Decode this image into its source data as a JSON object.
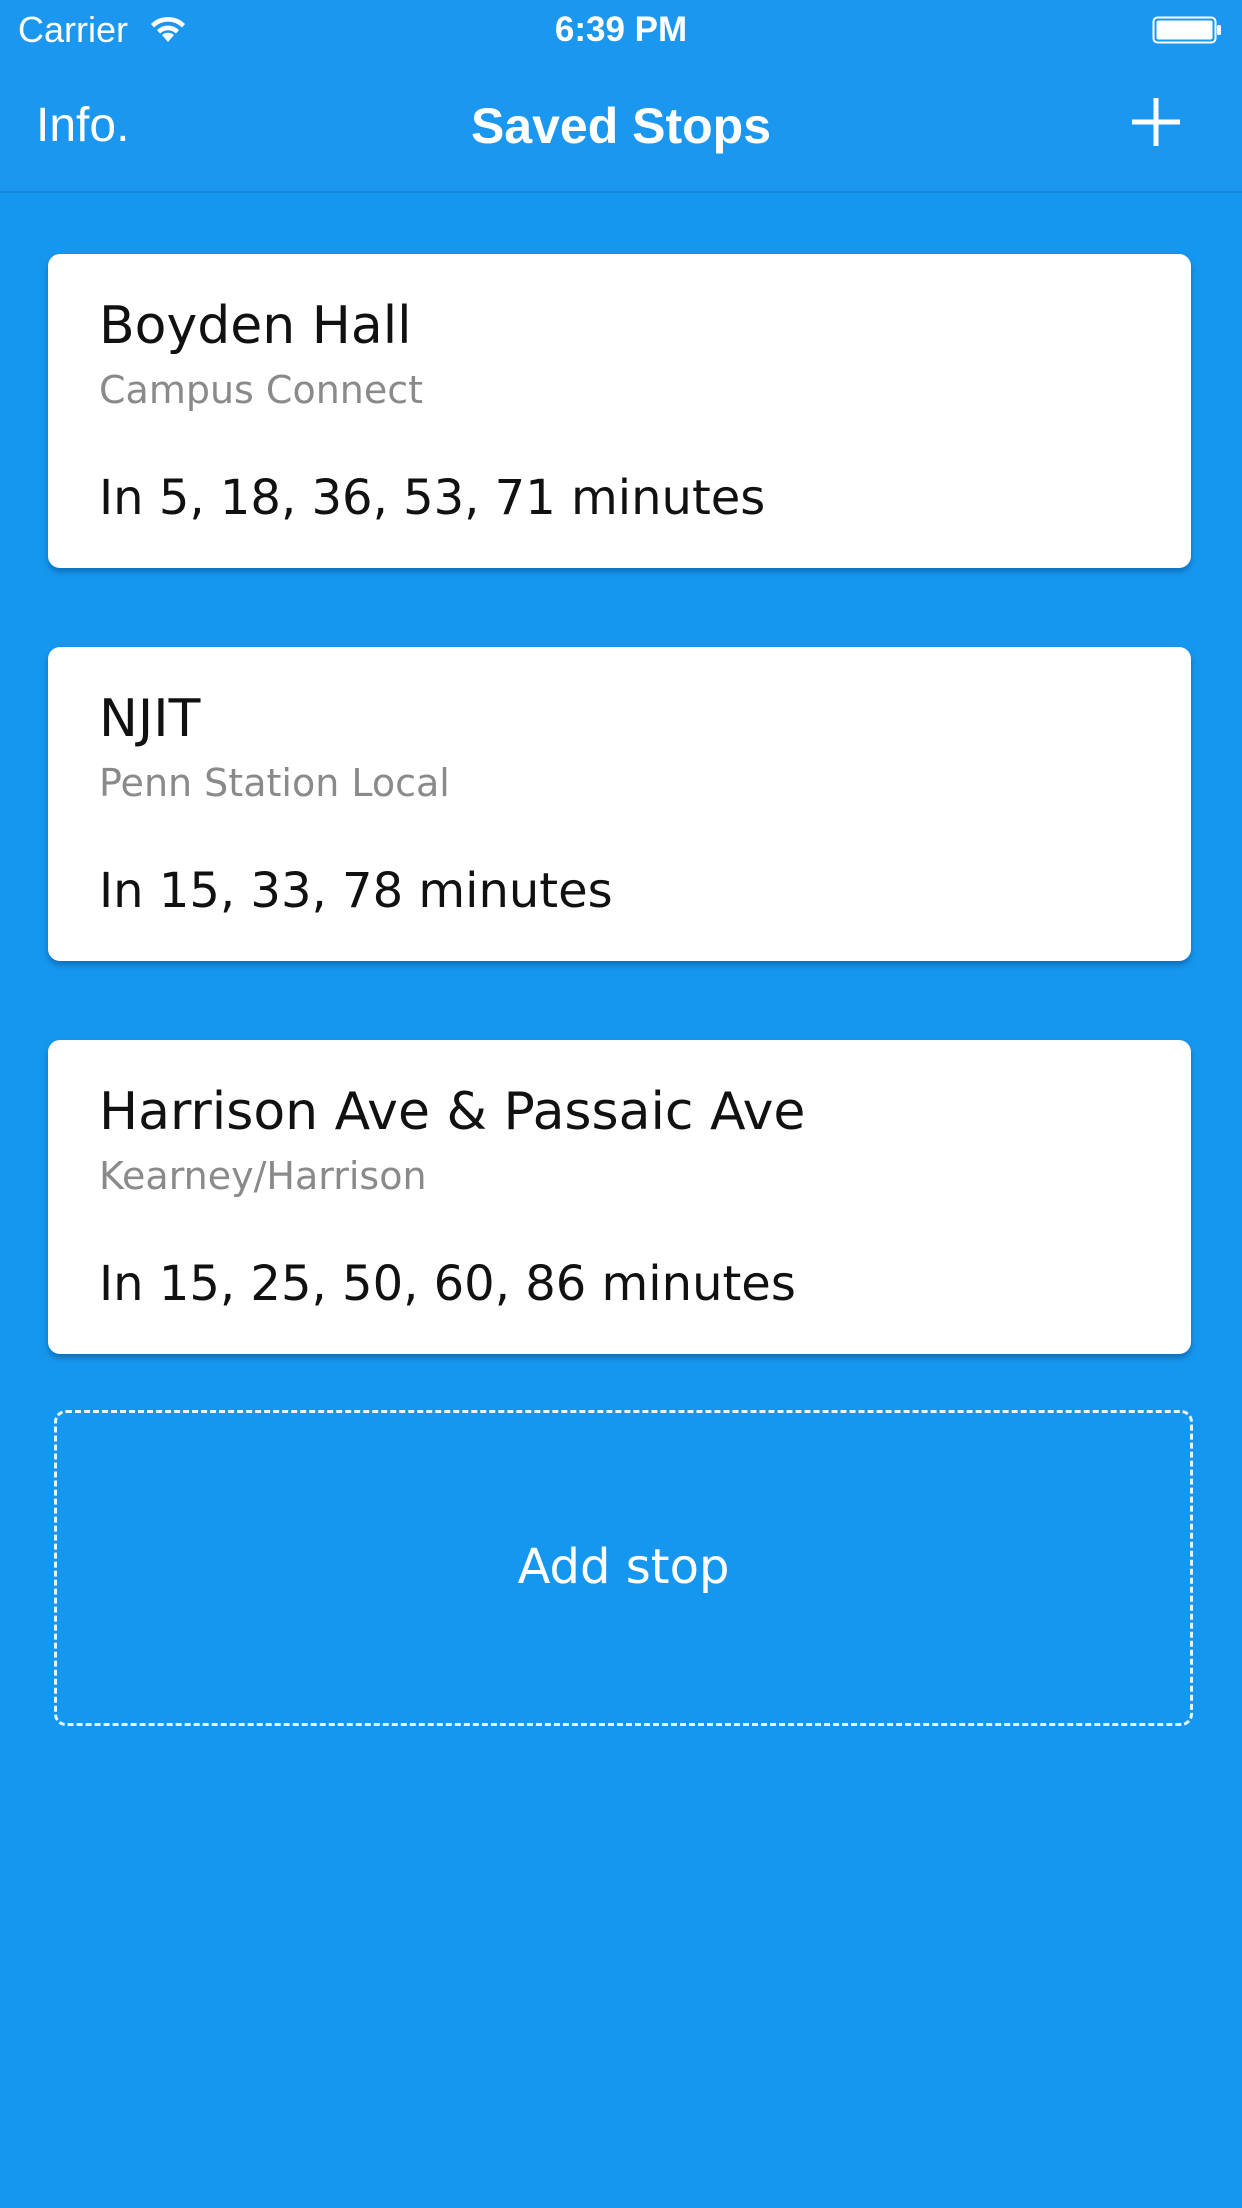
{
  "status_bar": {
    "carrier": "Carrier",
    "time": "6:39 PM"
  },
  "nav": {
    "left_label": "Info.",
    "title": "Saved Stops",
    "add_icon": "plus-icon"
  },
  "stops": [
    {
      "name": "Boyden Hall",
      "route": "Campus Connect",
      "arrivals": "In 5, 18, 36, 53, 71 minutes"
    },
    {
      "name": "NJIT",
      "route": "Penn Station Local",
      "arrivals": "In 15, 33, 78 minutes"
    },
    {
      "name": "Harrison Ave & Passaic Ave",
      "route": "Kearney/Harrison",
      "arrivals": "In 15, 25, 50, 60, 86 minutes"
    }
  ],
  "add_stop": {
    "label": "Add stop"
  },
  "colors": {
    "background": "#1597ef",
    "navbar": "#1c97f0",
    "card": "#ffffff",
    "subtitle": "#8a8a8a"
  }
}
